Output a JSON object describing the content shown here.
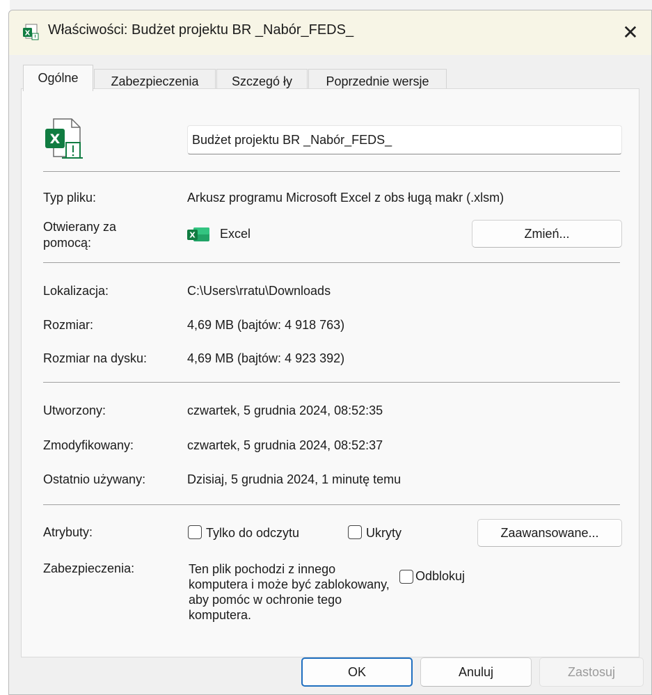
{
  "window": {
    "title": "Właściwości: Budżet projektu BR _Nabór_FEDS_",
    "close_symbol": "✕"
  },
  "tabs": [
    {
      "label": "Ogólne",
      "active": true
    },
    {
      "label": "Zabezpieczenia",
      "active": false
    },
    {
      "label": "Szczegó ły",
      "active": false
    },
    {
      "label": "Poprzednie wersje",
      "active": false
    }
  ],
  "general": {
    "file_name": "Budżet projektu BR _Nabór_FEDS_",
    "file_type_label": "Typ pliku:",
    "file_type_value": "Arkusz programu Microsoft Excel z obs ługą makr (.xlsm)",
    "opens_with_label_1": "Otwierany za",
    "opens_with_label_2": "pomocą:",
    "opens_with_value": "Excel",
    "change_button": "Zmień...",
    "location_label": "Lokalizacja:",
    "location_value": "C:\\Users\\rratu\\Downloads",
    "size_label": "Rozmiar:",
    "size_value": "4,69 MB (bajtów: 4 918 763)",
    "disk_size_label": "Rozmiar na dysku:",
    "disk_size_value": "4,69 MB (bajtów: 4 923 392)",
    "created_label": "Utworzony:",
    "created_value": "czwartek, 5 grudnia 2024, 08:52:35",
    "modified_label": "Zmodyfikowany:",
    "modified_value": "czwartek, 5 grudnia 2024, 08:52:37",
    "accessed_label": "Ostatnio używany:",
    "accessed_value": "Dzisiaj, 5 grudnia 2024, 1 minutę temu",
    "attributes_label": "Atrybuty:",
    "readonly_label": "Tylko do odczytu",
    "hidden_label": "Ukryty",
    "advanced_button": "Zaawansowane...",
    "security_label": "Zabezpieczenia:",
    "security_text": "Ten plik pochodzi z innego komputera i może być zablokowany, aby pomóc w ochronie tego komputera.",
    "unblock_label": "Odblokuj"
  },
  "footer": {
    "ok": "OK",
    "cancel": "Anuluj",
    "apply": "Zastosuj"
  },
  "colors": {
    "excel_green": "#107c41",
    "accent_blue": "#1f6fc0"
  },
  "icons": {
    "title_icon": "excel-macro-file-icon",
    "file_icon": "excel-macro-file-icon",
    "app_icon": "excel-app-icon"
  }
}
